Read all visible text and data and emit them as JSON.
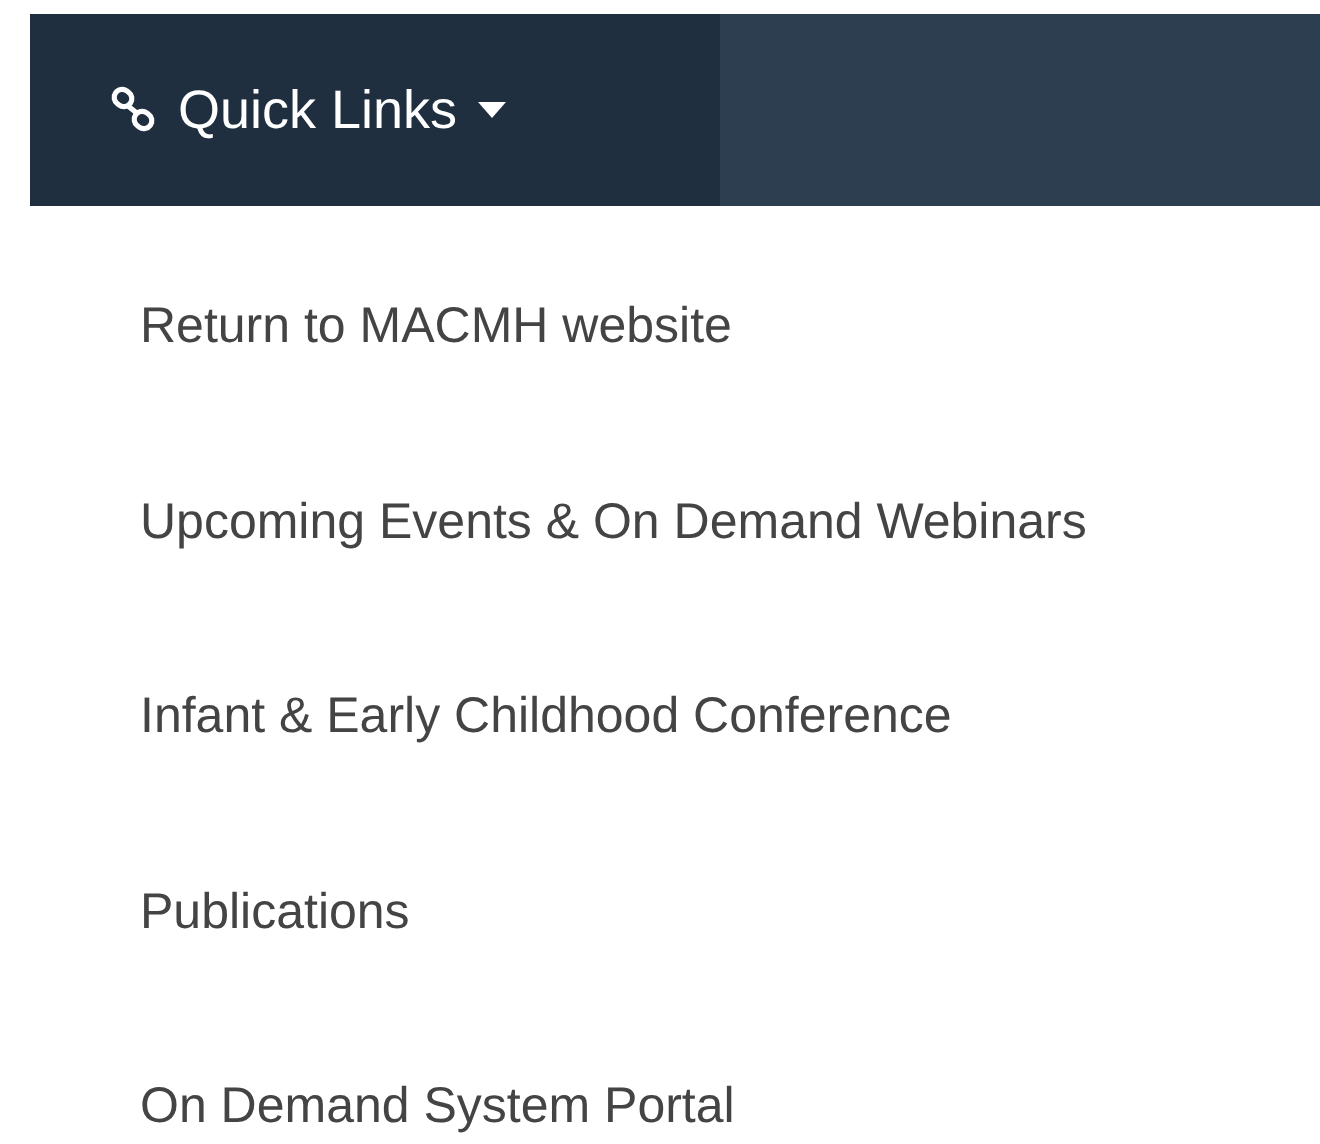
{
  "quick_links": {
    "label": "Quick Links",
    "expanded": true,
    "items": [
      {
        "label": "Return to MACMH website"
      },
      {
        "label": "Upcoming Events & On Demand Webinars"
      },
      {
        "label": "Infant & Early Childhood Conference"
      },
      {
        "label": "Publications"
      },
      {
        "label": "On Demand System Portal"
      }
    ]
  }
}
